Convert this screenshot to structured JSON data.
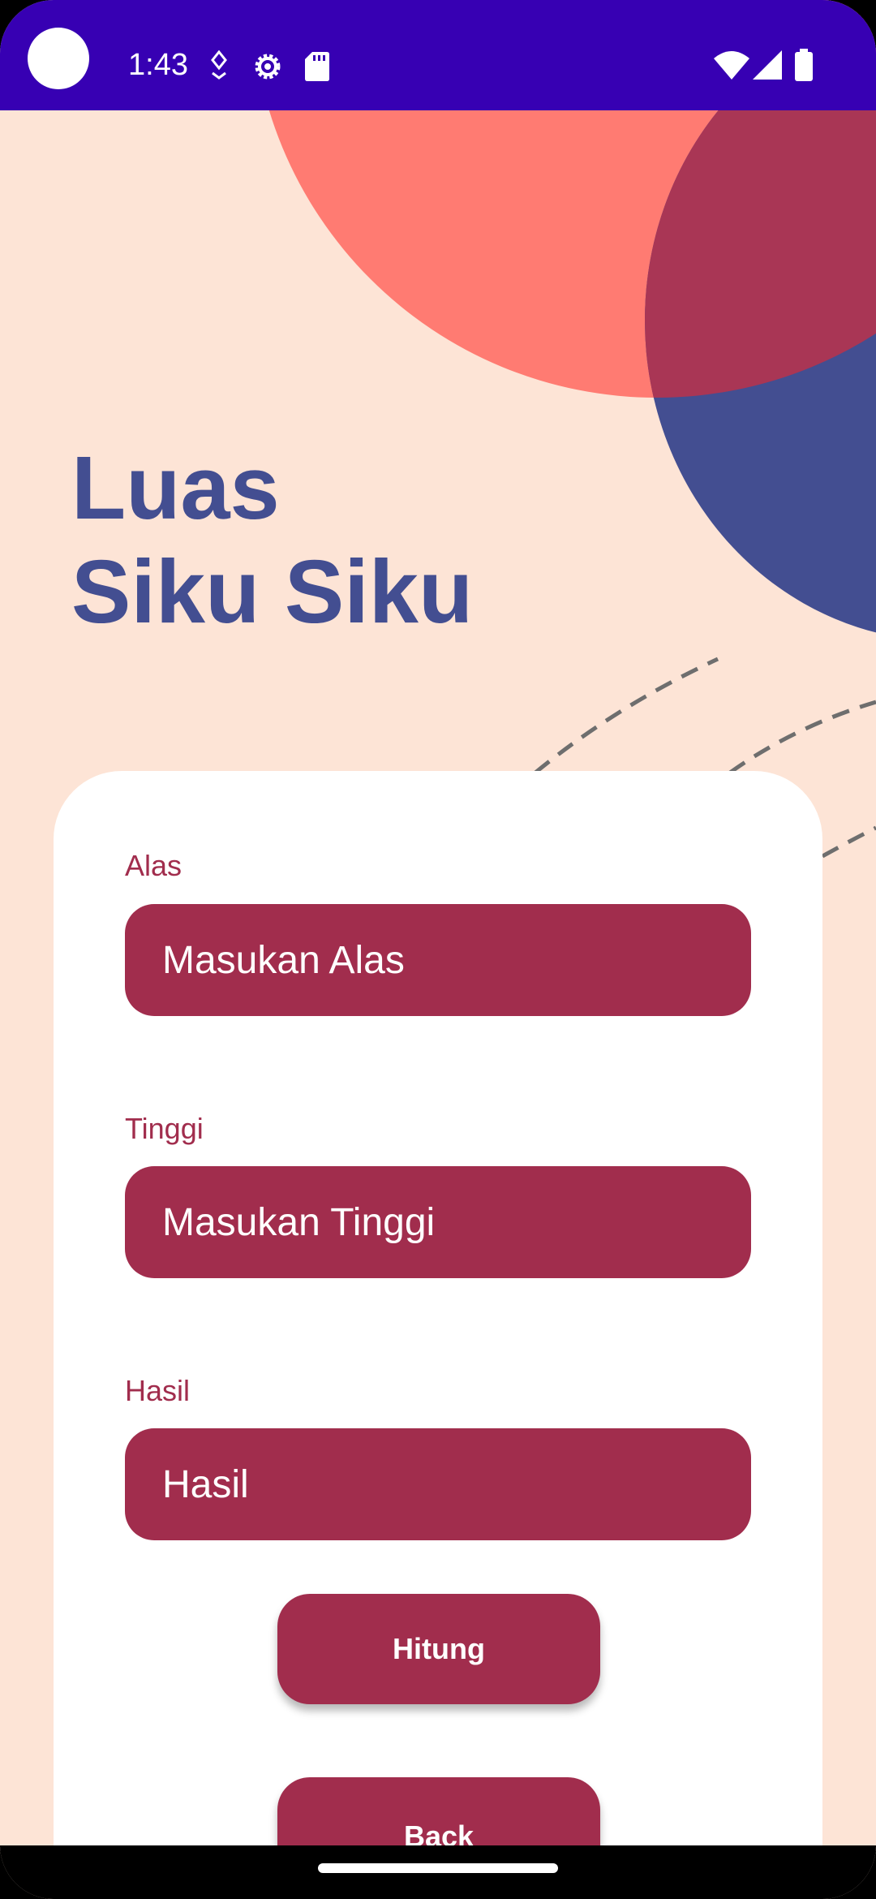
{
  "status_bar": {
    "time": "1:43",
    "left_icons": [
      "camera-cutout",
      "data-saver-icon",
      "settings-gear-icon",
      "sd-card-icon"
    ],
    "right_icons": [
      "wifi-icon",
      "signal-icon",
      "battery-icon"
    ],
    "color": "#3700b3"
  },
  "header": {
    "title_line1": "Luas",
    "title_line2": "Siku Siku"
  },
  "form": {
    "alas": {
      "label": "Alas",
      "placeholder": "Masukan Alas"
    },
    "tinggi": {
      "label": "Tinggi",
      "placeholder": "Masukan Tinggi"
    },
    "hasil": {
      "label": "Hasil",
      "placeholder": "Hasil"
    },
    "hitung_label": "Hitung",
    "back_label": "Back"
  },
  "colors": {
    "background": "#fde4d6",
    "accent": "#a12d4d",
    "title": "#434e91",
    "coral": "#ff7b72",
    "navy": "#434e91"
  }
}
